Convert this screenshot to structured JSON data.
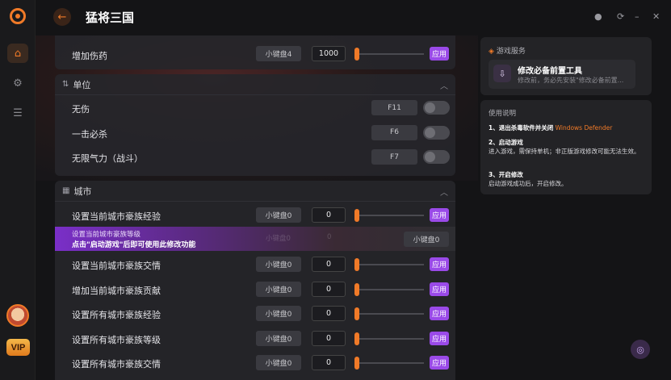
{
  "app": {
    "title": "猛将三国"
  },
  "window_controls": [
    "settings-icon",
    "refresh-icon",
    "minimize-icon",
    "close-icon"
  ],
  "rail": {
    "vip_label": "VIP"
  },
  "top_partial_row": {
    "label": "增加伤药",
    "key": "小键盘4",
    "value": "1000",
    "apply": "应用"
  },
  "unit_section": {
    "title": "单位",
    "rows": [
      {
        "label": "无伤",
        "key": "F11"
      },
      {
        "label": "一击必杀",
        "key": "F6"
      },
      {
        "label": "无限气力（战斗）",
        "key": "F7"
      }
    ]
  },
  "city_section": {
    "title": "城市",
    "rows": [
      {
        "label": "设置当前城市豪族经验",
        "key": "小键盘0",
        "value": "0",
        "apply": "应用"
      },
      {
        "label": "设置当前城市豪族交情",
        "key": "小键盘0",
        "value": "0",
        "apply": "应用"
      },
      {
        "label": "增加当前城市豪族贡献",
        "key": "小键盘0",
        "value": "0",
        "apply": "应用"
      },
      {
        "label": "设置所有城市豪族经验",
        "key": "小键盘0",
        "value": "0",
        "apply": "应用"
      },
      {
        "label": "设置所有城市豪族等级",
        "key": "小键盘0",
        "value": "0",
        "apply": "应用"
      },
      {
        "label": "设置所有城市豪族交情",
        "key": "小键盘0",
        "value": "0",
        "apply": "应用"
      }
    ],
    "locked_row": {
      "label": "设置当前城市豪族等级",
      "notice": "点击\"启动游戏\"后即可使用此修改功能",
      "ghost_key": "小键盘0",
      "ghost_value": "0",
      "key": "小键盘0"
    }
  },
  "services": {
    "title": "游戏服务",
    "tool_title": "修改必备前置工具",
    "tool_subtitle": "修改前，务必先安装\"修改必备前置..."
  },
  "usage": {
    "title": "使用说明",
    "step1_title": "1、退出杀毒软件并关闭",
    "step1_highlight": "Windows Defender",
    "step2_title": "2、启动游戏",
    "step2_text": "进入游戏，需保持单机；非正版游戏修改可能无法生效。",
    "step3_title": "3、开启修改",
    "step3_text": "启动游戏成功后，开启修改。"
  }
}
